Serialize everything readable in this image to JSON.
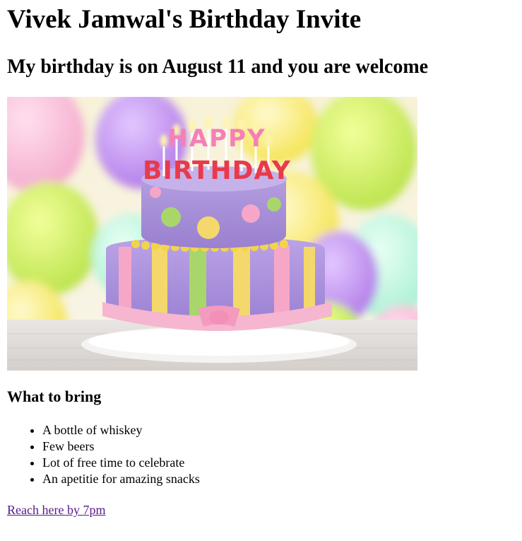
{
  "header": {
    "title": "Vivek Jamwal's Birthday Invite",
    "subtitle": "My birthday is on August 11 and you are welcome"
  },
  "image": {
    "cake_text_top": "HAPPY",
    "cake_text_bottom": "BIRTHDAY"
  },
  "bring": {
    "heading": "What to bring",
    "items": [
      "A bottle of whiskey",
      "Few beers",
      "Lot of free time to celebrate",
      "An apetitie for amazing snacks"
    ]
  },
  "link": {
    "label": "Reach here by 7pm"
  },
  "colors": {
    "link": "#551a8b",
    "cake_top": "#a98fd6",
    "cake_bottom": "#b79be0",
    "ribbon": "#f6b6cf"
  }
}
